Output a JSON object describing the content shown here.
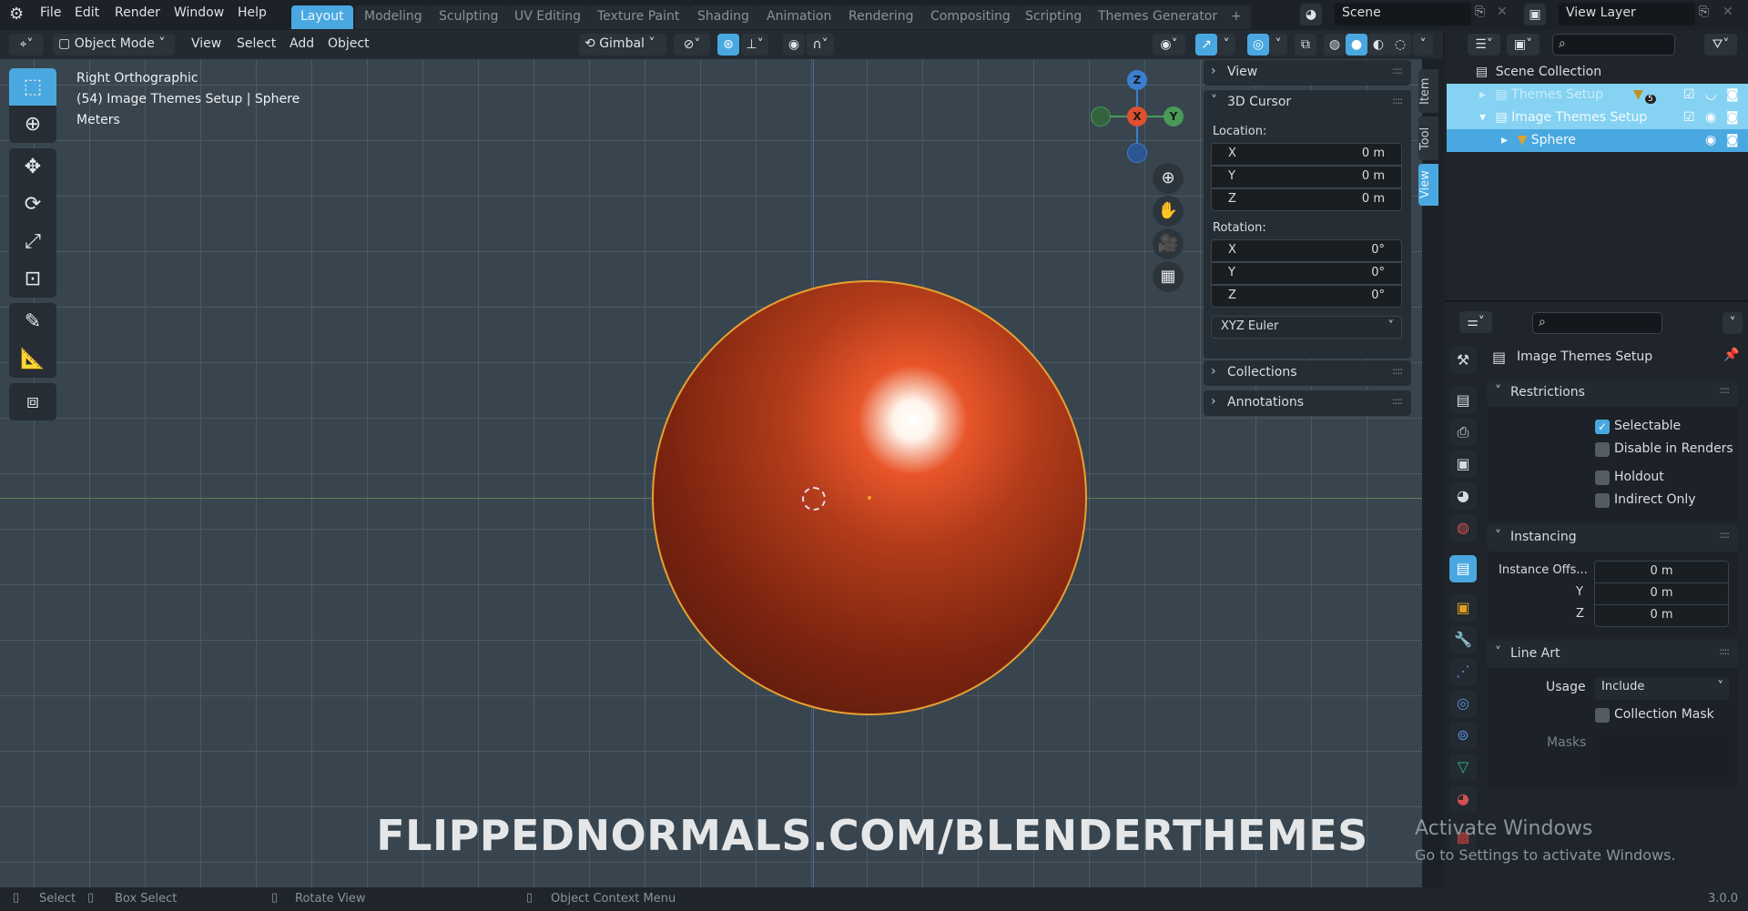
{
  "menu": {
    "items": [
      "File",
      "Edit",
      "Render",
      "Window",
      "Help"
    ]
  },
  "workspaces": [
    "Layout",
    "Modeling",
    "Sculpting",
    "UV Editing",
    "Texture Paint",
    "Shading",
    "Animation",
    "Rendering",
    "Compositing",
    "Scripting",
    "Themes Generator",
    "+"
  ],
  "scene": {
    "name": "Scene",
    "view_layer": "View Layer"
  },
  "toolbar": {
    "mode": "Object Mode",
    "view": "View",
    "select": "Select",
    "add": "Add",
    "object": "Object",
    "orientation": "Gimbal"
  },
  "viewport": {
    "view_name": "Right Orthographic",
    "context": "(54) Image Themes Setup | Sphere",
    "units": "Meters",
    "watermark": "FLIPPEDNORMALS.COM/BLENDERTHEMES",
    "gizmo": {
      "x": "X",
      "y": "Y",
      "z": "Z"
    },
    "sphere_color": "#b8401c",
    "selection_outline": "#e8a030"
  },
  "npanel": {
    "view": "View",
    "cursor": "3D Cursor",
    "location_label": "Location:",
    "location": [
      {
        "axis": "X",
        "value": "0 m"
      },
      {
        "axis": "Y",
        "value": "0 m"
      },
      {
        "axis": "Z",
        "value": "0 m"
      }
    ],
    "rotation_label": "Rotation:",
    "rotation": [
      {
        "axis": "X",
        "value": "0°"
      },
      {
        "axis": "Y",
        "value": "0°"
      },
      {
        "axis": "Z",
        "value": "0°"
      }
    ],
    "rotation_mode": "XYZ Euler",
    "collections": "Collections",
    "annotations": "Annotations",
    "tabs": [
      "Item",
      "Tool",
      "View"
    ]
  },
  "outliner": {
    "root": "Scene Collection",
    "items": [
      {
        "name": "Themes Setup",
        "badge": "5"
      },
      {
        "name": "Image Themes Setup"
      },
      {
        "name": "Sphere"
      }
    ]
  },
  "properties": {
    "title": "Image Themes Setup",
    "restrictions": {
      "header": "Restrictions",
      "selectable": "Selectable",
      "disable_renders": "Disable in Renders",
      "holdout": "Holdout",
      "indirect_only": "Indirect Only"
    },
    "instancing": {
      "header": "Instancing",
      "offset_label": "Instance Offs...",
      "y_label": "Y",
      "z_label": "Z",
      "x": "0 m",
      "y": "0 m",
      "z": "0 m"
    },
    "line_art": {
      "header": "Line Art",
      "usage_label": "Usage",
      "usage": "Include",
      "collection_mask": "Collection Mask",
      "masks_label": "Masks"
    }
  },
  "status": {
    "select": "Select",
    "box_select": "Box Select",
    "rotate": "Rotate View",
    "context_menu": "Object Context Menu",
    "version": "3.0.0"
  },
  "activation": {
    "title": "Activate Windows",
    "subtitle": "Go to Settings to activate Windows."
  },
  "colors": {
    "accent": "#4aa8e0",
    "viewport_bg": "#38454f",
    "x_axis": "#e0502e",
    "y_axis": "#4a9a58",
    "z_axis": "#3a7fd0"
  }
}
